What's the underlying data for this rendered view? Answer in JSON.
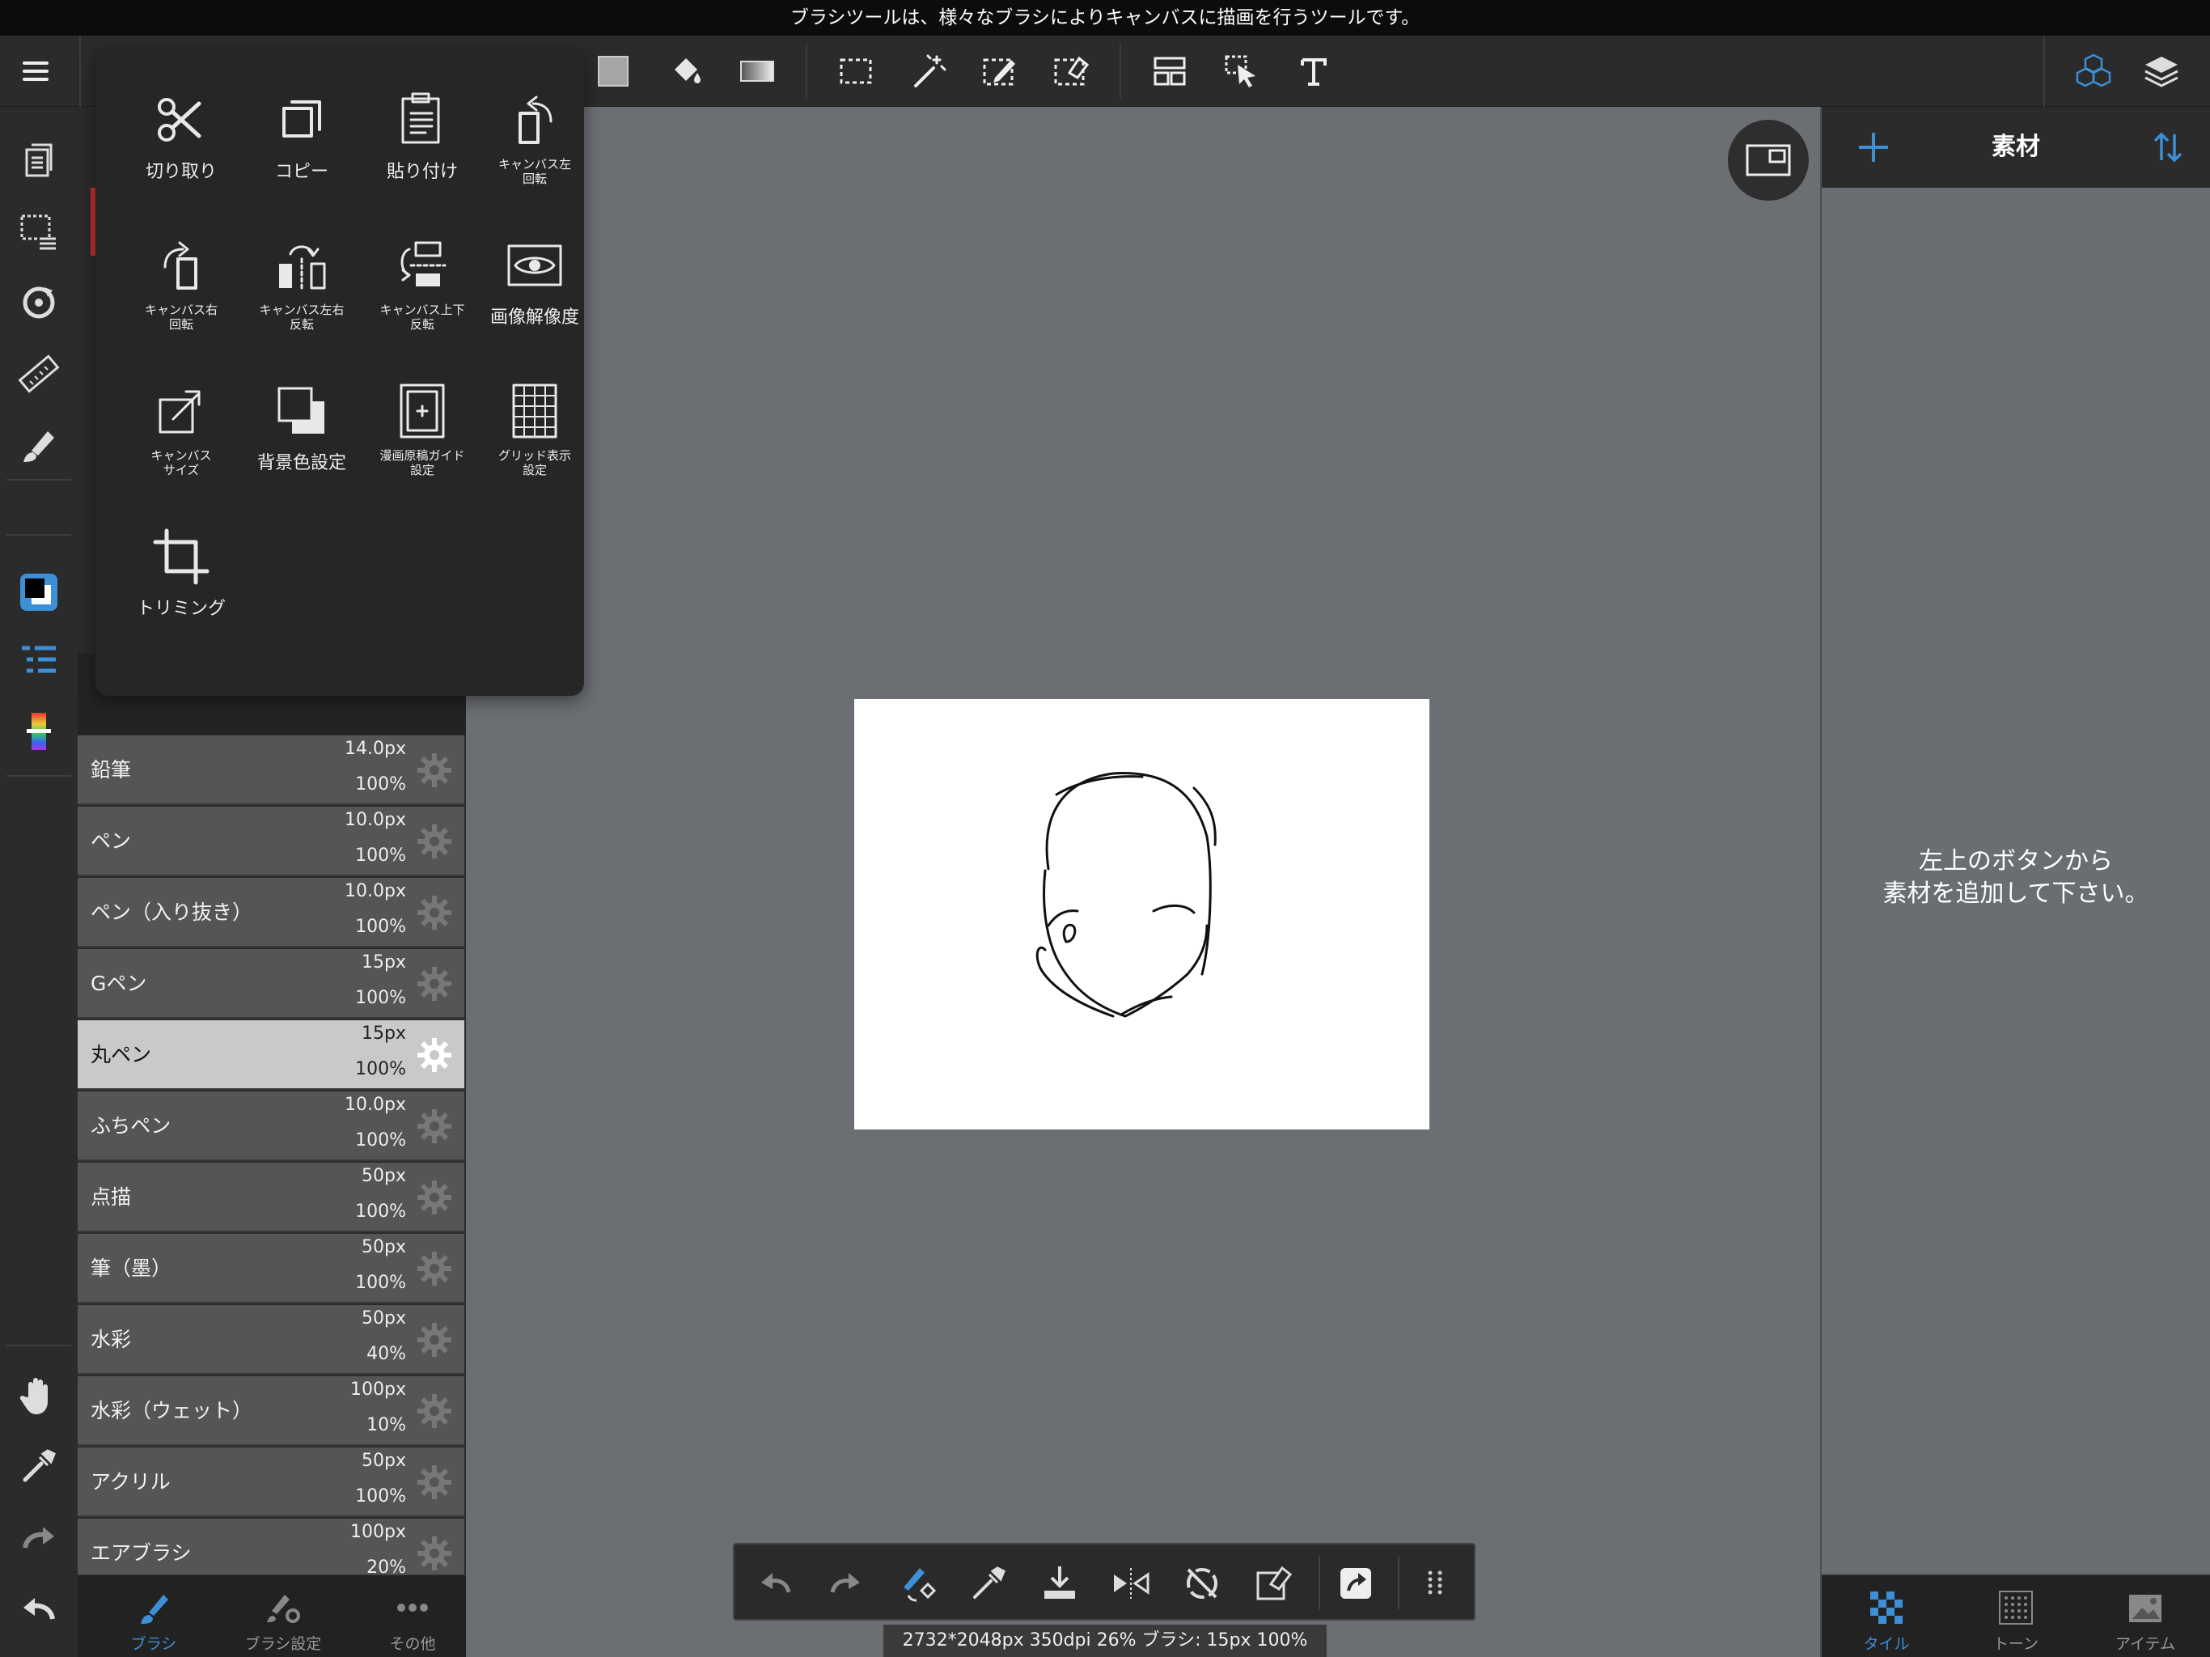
{
  "status_message": "ブラシツールは、様々なブラシによりキャンバスに描画を行うツールです。",
  "colors": {
    "accent": "#3d8fd6",
    "selected_row": "#c9c9c9",
    "panel": "#2b2b2b",
    "workspace": "#6b6e73",
    "red_marker": "#c0302a"
  },
  "toolbar": {
    "icons": [
      "menu-icon",
      "color-swatch-icon",
      "bucket-icon",
      "gradient-icon",
      "rect-select-icon",
      "magic-wand-icon",
      "pen-select-icon",
      "eraser-select-icon",
      "layout-icon",
      "select-move-icon",
      "text-icon",
      "materials-icon",
      "layers-icon"
    ]
  },
  "left_tools": [
    "document-icon",
    "selection-icon",
    "rotate-icon",
    "ruler-icon",
    "brush-icon",
    "color-icon",
    "layer-list-icon",
    "color-bar-icon",
    "hand-icon",
    "eyedropper-icon",
    "redo-icon",
    "undo-icon"
  ],
  "brush_list": [
    {
      "name": "鉛筆",
      "size": "14.0px",
      "opacity": "100%",
      "selected": false
    },
    {
      "name": "ペン",
      "size": "10.0px",
      "opacity": "100%",
      "selected": false
    },
    {
      "name": "ペン（入り抜き）",
      "size": "10.0px",
      "opacity": "100%",
      "selected": false
    },
    {
      "name": "Gペン",
      "size": "15px",
      "opacity": "100%",
      "selected": false
    },
    {
      "name": "丸ペン",
      "size": "15px",
      "opacity": "100%",
      "selected": true
    },
    {
      "name": "ふちペン",
      "size": "10.0px",
      "opacity": "100%",
      "selected": false
    },
    {
      "name": "点描",
      "size": "50px",
      "opacity": "100%",
      "selected": false
    },
    {
      "name": "筆（墨）",
      "size": "50px",
      "opacity": "100%",
      "selected": false
    },
    {
      "name": "水彩",
      "size": "50px",
      "opacity": "40%",
      "selected": false
    },
    {
      "name": "水彩（ウェット）",
      "size": "100px",
      "opacity": "10%",
      "selected": false
    },
    {
      "name": "アクリル",
      "size": "50px",
      "opacity": "100%",
      "selected": false
    },
    {
      "name": "エアブラシ",
      "size": "100px",
      "opacity": "20%",
      "selected": false
    }
  ],
  "brush_tabs": [
    {
      "label": "ブラシ",
      "icon": "brush-icon",
      "active": true
    },
    {
      "label": "ブラシ設定",
      "icon": "brush-settings-icon",
      "active": false
    },
    {
      "label": "その他",
      "icon": "more-icon",
      "active": false
    }
  ],
  "popup_menu": [
    {
      "label": "切り取り",
      "icon": "scissors-icon",
      "small": false
    },
    {
      "label": "コピー",
      "icon": "copy-icon",
      "small": false
    },
    {
      "label": "貼り付け",
      "icon": "paste-icon",
      "small": false
    },
    {
      "label": "キャンバス左\n回転",
      "icon": "rotate-left-icon",
      "small": true
    },
    {
      "label": "キャンバス右\n回転",
      "icon": "rotate-right-icon",
      "small": true
    },
    {
      "label": "キャンバス左右\n反転",
      "icon": "flip-horizontal-icon",
      "small": true
    },
    {
      "label": "キャンバス上下\n反転",
      "icon": "flip-vertical-icon",
      "small": true
    },
    {
      "label": "画像解像度",
      "icon": "eye-icon",
      "small": false
    },
    {
      "label": "キャンバス\nサイズ",
      "icon": "canvas-size-icon",
      "small": true
    },
    {
      "label": "背景色設定",
      "icon": "background-color-icon",
      "small": false
    },
    {
      "label": "漫画原稿ガイド\n設定",
      "icon": "manga-guide-icon",
      "small": true
    },
    {
      "label": "グリッド表示\n設定",
      "icon": "grid-icon",
      "small": true
    },
    {
      "label": "トリミング",
      "icon": "crop-icon",
      "small": false
    }
  ],
  "materials_panel": {
    "title": "素材",
    "empty_message_line1": "左上のボタンから",
    "empty_message_line2": "素材を追加して下さい。",
    "tabs": [
      {
        "label": "タイル",
        "icon": "tile-icon",
        "active": true
      },
      {
        "label": "トーン",
        "icon": "tone-icon",
        "active": false
      },
      {
        "label": "アイテム",
        "icon": "item-icon",
        "active": false
      }
    ]
  },
  "quick_bar": [
    "undo-icon",
    "redo-icon",
    "brush-eraser-toggle-icon",
    "eyedropper-icon",
    "save-icon",
    "symmetry-icon",
    "rotation-lock-icon",
    "clear-icon",
    "share-icon",
    "more-dots-icon"
  ],
  "info_bar": "2732*2048px 350dpi 26% ブラシ: 15px 100%"
}
